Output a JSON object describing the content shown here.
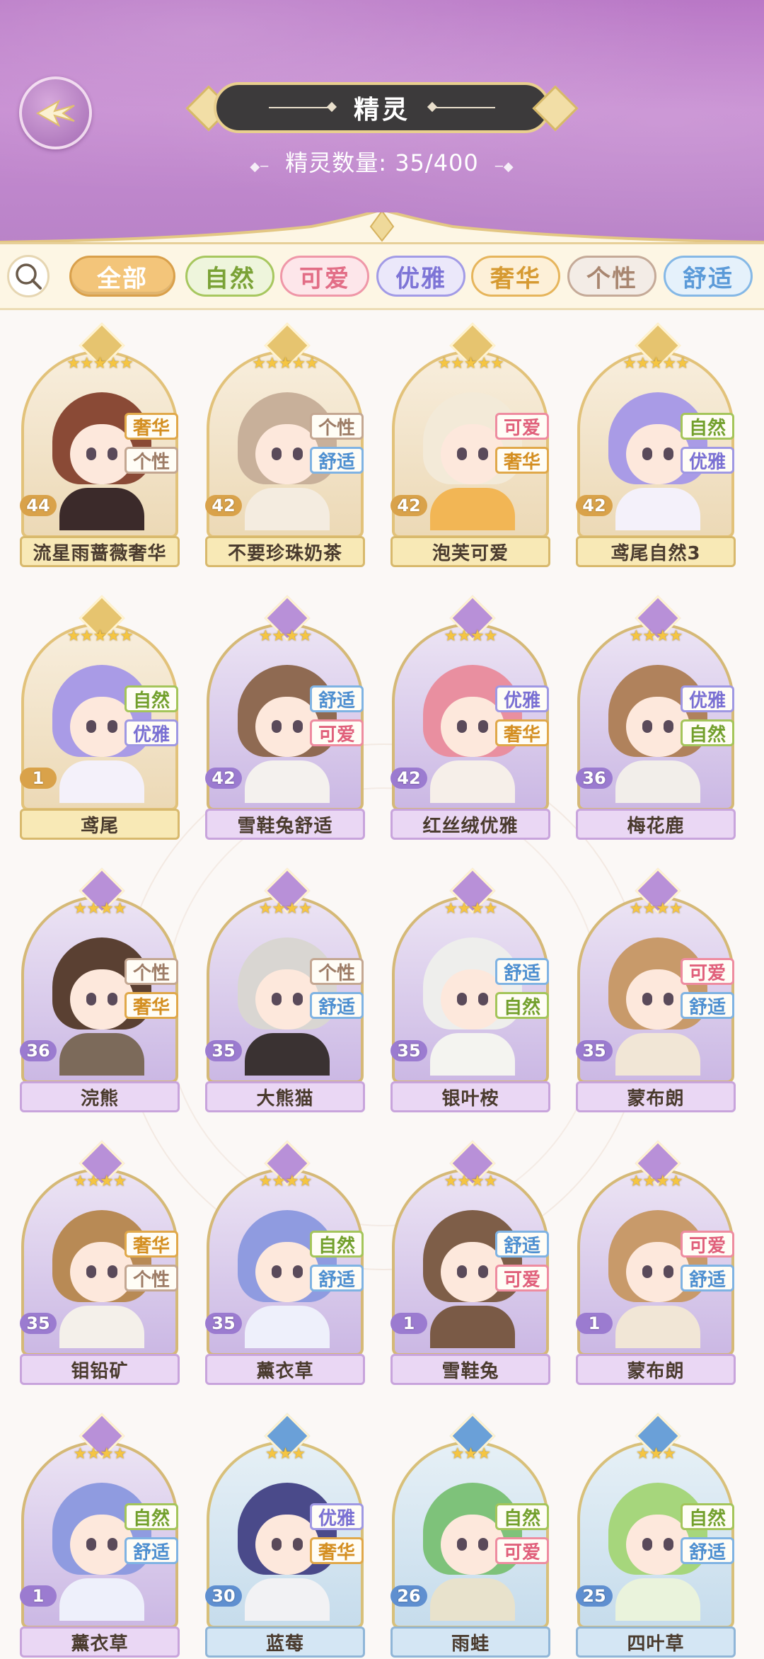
{
  "header": {
    "title": "精灵",
    "count_label": "精灵数量:",
    "count_value": "35/400"
  },
  "filters": [
    {
      "label": "全部",
      "active": true,
      "bg": "#f3c57a",
      "border": "#d9a04b",
      "color": "#ffffff"
    },
    {
      "label": "自然",
      "active": false,
      "bg": "#eef5dc",
      "border": "#a7c75f",
      "color": "#7aa236"
    },
    {
      "label": "可爱",
      "active": false,
      "bg": "#fde6ea",
      "border": "#ef97a8",
      "color": "#e26d86"
    },
    {
      "label": "优雅",
      "active": false,
      "bg": "#ebe8fa",
      "border": "#a29be6",
      "color": "#7d74d6"
    },
    {
      "label": "奢华",
      "active": false,
      "bg": "#fdf0d8",
      "border": "#e6b55c",
      "color": "#d69a32"
    },
    {
      "label": "个性",
      "active": false,
      "bg": "#f3ece6",
      "border": "#c5aa98",
      "color": "#a88670"
    },
    {
      "label": "舒适",
      "active": false,
      "bg": "#e5f1fb",
      "border": "#85b8e6",
      "color": "#5b9ad8"
    }
  ],
  "tag_styles": {
    "奢华": {
      "border": "#e0a84a",
      "color": "#d48f22"
    },
    "个性": {
      "border": "#c4a792",
      "color": "#9d7c66"
    },
    "舒适": {
      "border": "#7fb3e3",
      "color": "#4e8fd0"
    },
    "可爱": {
      "border": "#ee8ca0",
      "color": "#e0607b"
    },
    "自然": {
      "border": "#a4c55a",
      "color": "#73a02d"
    },
    "优雅": {
      "border": "#9f98e3",
      "color": "#7a70d3"
    }
  },
  "spirits": [
    {
      "name": "流星雨蔷薇奢华",
      "level": "44",
      "stars": "★★★★★",
      "tags": [
        "奢华",
        "个性"
      ],
      "theme": "gold",
      "hair": "#8a4a36",
      "outfit": "#3b2a2a"
    },
    {
      "name": "不要珍珠奶茶",
      "level": "42",
      "stars": "★★★★★",
      "tags": [
        "个性",
        "舒适"
      ],
      "theme": "gold",
      "hair": "#c8b09a",
      "outfit": "#f4ece0"
    },
    {
      "name": "泡芙可爱",
      "level": "42",
      "stars": "★★★★★",
      "tags": [
        "可爱",
        "奢华"
      ],
      "theme": "gold",
      "hair": "#f3ead8",
      "outfit": "#f2b655"
    },
    {
      "name": "鸢尾自然3",
      "level": "42",
      "stars": "★★★★★",
      "tags": [
        "自然",
        "优雅"
      ],
      "theme": "gold",
      "hair": "#a99be6",
      "outfit": "#f4f1fa"
    },
    {
      "name": "鸢尾",
      "level": "1",
      "stars": "★★★★★",
      "tags": [
        "自然",
        "优雅"
      ],
      "theme": "gold",
      "hair": "#a99be6",
      "outfit": "#f4f1fa"
    },
    {
      "name": "雪鞋兔舒适",
      "level": "42",
      "stars": "★★★★",
      "tags": [
        "舒适",
        "可爱"
      ],
      "theme": "purple",
      "hair": "#8f6a52",
      "outfit": "#f4f1ee"
    },
    {
      "name": "红丝绒优雅",
      "level": "42",
      "stars": "★★★★",
      "tags": [
        "优雅",
        "奢华"
      ],
      "theme": "purple",
      "hair": "#e98fa0",
      "outfit": "#f6efe9"
    },
    {
      "name": "梅花鹿",
      "level": "36",
      "stars": "★★★★",
      "tags": [
        "优雅",
        "自然"
      ],
      "theme": "purple",
      "hair": "#b0825c",
      "outfit": "#f2eeea"
    },
    {
      "name": "浣熊",
      "level": "36",
      "stars": "★★★★",
      "tags": [
        "个性",
        "奢华"
      ],
      "theme": "purple",
      "hair": "#5a4032",
      "outfit": "#7c6a5a"
    },
    {
      "name": "大熊猫",
      "level": "35",
      "stars": "★★★★",
      "tags": [
        "个性",
        "舒适"
      ],
      "theme": "purple",
      "hair": "#d9d6d2",
      "outfit": "#3a3232"
    },
    {
      "name": "银叶桉",
      "level": "35",
      "stars": "★★★★",
      "tags": [
        "舒适",
        "自然"
      ],
      "theme": "purple",
      "hair": "#eeeeec",
      "outfit": "#f4f4f0"
    },
    {
      "name": "蒙布朗",
      "level": "35",
      "stars": "★★★★",
      "tags": [
        "可爱",
        "舒适"
      ],
      "theme": "purple",
      "hair": "#c89a6a",
      "outfit": "#f1e6d6"
    },
    {
      "name": "钼铅矿",
      "level": "35",
      "stars": "★★★★",
      "tags": [
        "奢华",
        "个性"
      ],
      "theme": "purple",
      "hair": "#b88a55",
      "outfit": "#f4f0ea"
    },
    {
      "name": "薰衣草",
      "level": "35",
      "stars": "★★★★",
      "tags": [
        "自然",
        "舒适"
      ],
      "theme": "purple",
      "hair": "#8f9be0",
      "outfit": "#eef0fb"
    },
    {
      "name": "雪鞋兔",
      "level": "1",
      "stars": "★★★★",
      "tags": [
        "舒适",
        "可爱"
      ],
      "theme": "purple",
      "hair": "#7e5e48",
      "outfit": "#7a5a46"
    },
    {
      "name": "蒙布朗",
      "level": "1",
      "stars": "★★★★",
      "tags": [
        "可爱",
        "舒适"
      ],
      "theme": "purple",
      "hair": "#c89a6a",
      "outfit": "#f1e6d6"
    },
    {
      "name": "薰衣草",
      "level": "1",
      "stars": "★★★★",
      "tags": [
        "自然",
        "舒适"
      ],
      "theme": "purple",
      "hair": "#8f9be0",
      "outfit": "#eef0fb"
    },
    {
      "name": "蓝莓",
      "level": "30",
      "stars": "★★★",
      "tags": [
        "优雅",
        "奢华"
      ],
      "theme": "blue",
      "hair": "#4a4a8a",
      "outfit": "#f2f2f4"
    },
    {
      "name": "雨蛙",
      "level": "26",
      "stars": "★★★",
      "tags": [
        "自然",
        "可爱"
      ],
      "theme": "blue",
      "hair": "#7ec27a",
      "outfit": "#e8e2cc"
    },
    {
      "name": "四叶草",
      "level": "25",
      "stars": "★★★",
      "tags": [
        "自然",
        "舒适"
      ],
      "theme": "blue",
      "hair": "#a6d67c",
      "outfit": "#eaf3dc"
    }
  ]
}
